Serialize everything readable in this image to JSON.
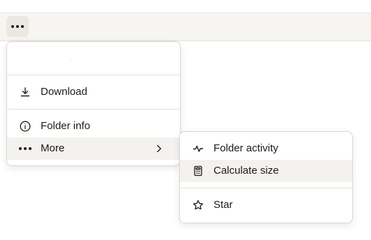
{
  "toolbar": {
    "more_icon": "more-horizontal-icon"
  },
  "main_menu": {
    "items": [
      {
        "label": "Download",
        "icon": "download-icon"
      },
      {
        "label": "Folder info",
        "icon": "info-icon"
      },
      {
        "label": "More",
        "icon": "more-horizontal-icon",
        "trailing_icon": "chevron-right-icon"
      }
    ]
  },
  "submenu": {
    "items": [
      {
        "label": "Folder activity",
        "icon": "activity-icon"
      },
      {
        "label": "Calculate size",
        "icon": "calculator-icon"
      },
      {
        "label": "Star",
        "icon": "star-icon"
      }
    ]
  },
  "colors": {
    "text": "#1e1919",
    "toolbar_bg": "#f7f5f2",
    "hover_bg": "#f4f2ef",
    "border": "#dcd8d2"
  }
}
